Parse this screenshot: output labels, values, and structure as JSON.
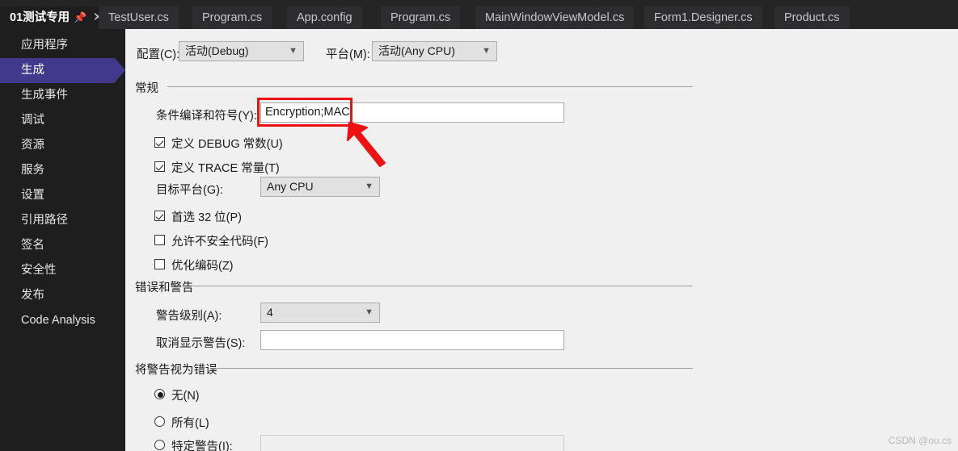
{
  "tabs": [
    {
      "label": "01测试专用",
      "active": true,
      "pin_icon": "pin-icon",
      "close_icon": "close-icon"
    },
    {
      "label": "TestUser.cs",
      "active": false
    },
    {
      "label": "Program.cs",
      "active": false
    },
    {
      "label": "App.config",
      "active": false
    },
    {
      "label": "Program.cs",
      "active": false
    },
    {
      "label": "MainWindowViewModel.cs",
      "active": false
    },
    {
      "label": "Form1.Designer.cs",
      "active": false
    },
    {
      "label": "Product.cs",
      "active": false
    }
  ],
  "sidebar": {
    "items": [
      {
        "label": "应用程序",
        "selected": false
      },
      {
        "label": "生成",
        "selected": true
      },
      {
        "label": "生成事件",
        "selected": false
      },
      {
        "label": "调试",
        "selected": false
      },
      {
        "label": "资源",
        "selected": false
      },
      {
        "label": "服务",
        "selected": false
      },
      {
        "label": "设置",
        "selected": false
      },
      {
        "label": "引用路径",
        "selected": false
      },
      {
        "label": "签名",
        "selected": false
      },
      {
        "label": "安全性",
        "selected": false
      },
      {
        "label": "发布",
        "selected": false
      },
      {
        "label": "Code Analysis",
        "selected": false
      }
    ],
    "selected_color": "#413a8c"
  },
  "toolbar": {
    "configuration_label": "配置(C):",
    "configuration_value": "活动(Debug)",
    "platform_label": "平台(M):",
    "platform_value": "活动(Any CPU)"
  },
  "general": {
    "title": "常规",
    "symbols_label": "条件编译和符号(Y):",
    "symbols_value": "Encryption;MAC",
    "define_debug_label": "定义 DEBUG 常数(U)",
    "define_debug_checked": true,
    "define_trace_label": "定义 TRACE 常量(T)",
    "define_trace_checked": true,
    "platform_target_label": "目标平台(G):",
    "platform_target_value": "Any CPU",
    "prefer32_label": "首选 32 位(P)",
    "prefer32_checked": true,
    "unsafe_label": "允许不安全代码(F)",
    "unsafe_checked": false,
    "optimize_label": "优化编码(Z)",
    "optimize_checked": false
  },
  "errors_warnings": {
    "title": "错误和警告",
    "warning_level_label": "警告级别(A):",
    "warning_level_value": "4",
    "suppress_label": "取消显示警告(S):",
    "suppress_value": ""
  },
  "treat_warnings": {
    "title": "将警告视为错误",
    "none_label": "无(N)",
    "none_selected": true,
    "all_label": "所有(L)",
    "all_selected": false,
    "specific_label": "特定警告(I):",
    "specific_selected": false,
    "specific_value": ""
  },
  "annotation": {
    "color": "#ee1111",
    "box_name": "highlight-box-around-symbols-field",
    "arrow_name": "pointer-arrow"
  },
  "watermark": {
    "text": "CSDN @ou.cs"
  }
}
